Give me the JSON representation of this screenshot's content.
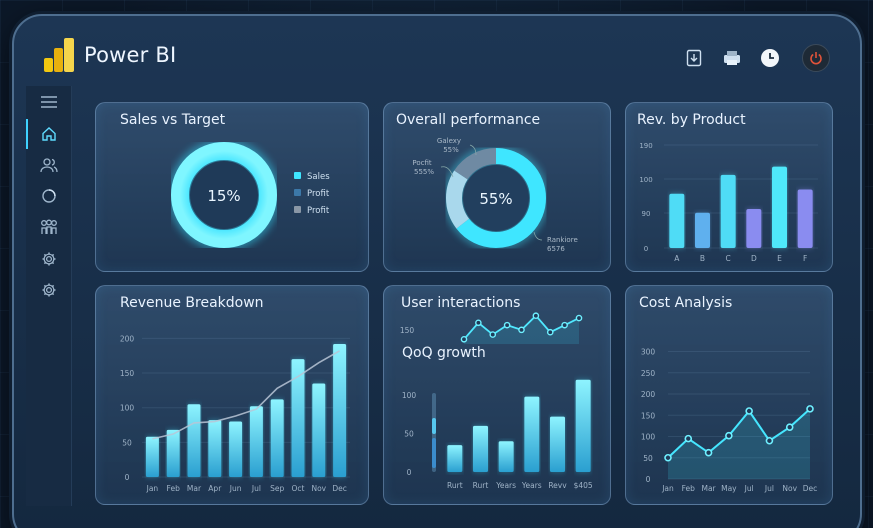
{
  "app": {
    "title": "Power BI"
  },
  "colors": {
    "accent": "#3fe6ff",
    "bar_top": "#7ef2ff",
    "bar_bottom": "#2aa8d8",
    "violet": "#8b8cf0"
  },
  "header": {
    "icons": [
      "upload-icon",
      "printer-icon",
      "clock-icon",
      "power-icon"
    ]
  },
  "sidebar": {
    "items": [
      "menu-icon",
      "home-icon",
      "users-icon",
      "circle-icon",
      "org-icon",
      "settings-icon",
      "settings-icon"
    ]
  },
  "cards": {
    "sales": {
      "title": "Sales vs Target",
      "center": "15%",
      "legend": [
        {
          "label": "Sales",
          "color": "#3fe6ff"
        },
        {
          "label": "Profit",
          "color": "#3c78a8"
        },
        {
          "label": "Profit",
          "color": "#8a97a6"
        }
      ]
    },
    "performance": {
      "title": "Overall performance",
      "center": "55%",
      "labels": {
        "a1": "Galexy",
        "a2": "55%",
        "b1": "Pocfit",
        "b2": "555%",
        "c1": "Rankiore",
        "c2": "6576"
      }
    },
    "rev": {
      "title": "Rev. by Product"
    },
    "revenue": {
      "title": "Revenue Breakdown"
    },
    "user": {
      "title": "User interactions",
      "subtitle": "QoQ growth"
    },
    "cost": {
      "title": "Cost Analysis"
    }
  },
  "chart_data": [
    {
      "id": "rev-by-product",
      "type": "bar",
      "title": "Rev. by Product",
      "categories": [
        "A",
        "B",
        "C",
        "D",
        "E",
        "F"
      ],
      "values": [
        100,
        65,
        135,
        72,
        150,
        108
      ],
      "yticks": [
        "190",
        "100",
        "90",
        "0"
      ],
      "ylim": [
        0,
        190
      ],
      "bar_colors": [
        "#4fdcf6",
        "#5fb0ee",
        "#4fdcf6",
        "#8a8cf0",
        "#4fe8fa",
        "#8a8cf0"
      ]
    },
    {
      "id": "revenue-breakdown",
      "type": "bar",
      "title": "Revenue Breakdown",
      "categories": [
        "Jan",
        "Feb",
        "Mar",
        "Apr",
        "Jun",
        "Jul",
        "Sep",
        "Oct",
        "Nov",
        "Dec"
      ],
      "values": [
        58,
        68,
        105,
        82,
        80,
        102,
        112,
        170,
        135,
        192
      ],
      "line": [
        55,
        62,
        78,
        80,
        88,
        98,
        128,
        145,
        165,
        182
      ],
      "yticks": [
        0,
        50,
        100,
        150,
        200
      ],
      "ylim": [
        0,
        215
      ]
    },
    {
      "id": "user-interactions",
      "type": "line",
      "title": "User interactions",
      "values": [
        150,
        185,
        160,
        180,
        170,
        200,
        165,
        180,
        195
      ],
      "ytick": "150"
    },
    {
      "id": "qoq-growth",
      "type": "bar",
      "title": "QoQ growth",
      "categories": [
        "Rurt",
        "Rurt",
        "Years",
        "Years",
        "Revv",
        "$405"
      ],
      "values": [
        35,
        60,
        40,
        98,
        72,
        120
      ],
      "yticks": [
        0,
        50,
        100
      ],
      "ylim": [
        0,
        130
      ]
    },
    {
      "id": "cost-analysis",
      "type": "area",
      "title": "Cost Analysis",
      "categories": [
        "Jan",
        "Feb",
        "Mar",
        "May",
        "Jul",
        "Jul",
        "Nov",
        "Dec"
      ],
      "values": [
        50,
        95,
        62,
        102,
        160,
        90,
        122,
        165
      ],
      "yticks": [
        0,
        50,
        100,
        150,
        200,
        250,
        300
      ],
      "ylim": [
        0,
        320
      ]
    }
  ]
}
